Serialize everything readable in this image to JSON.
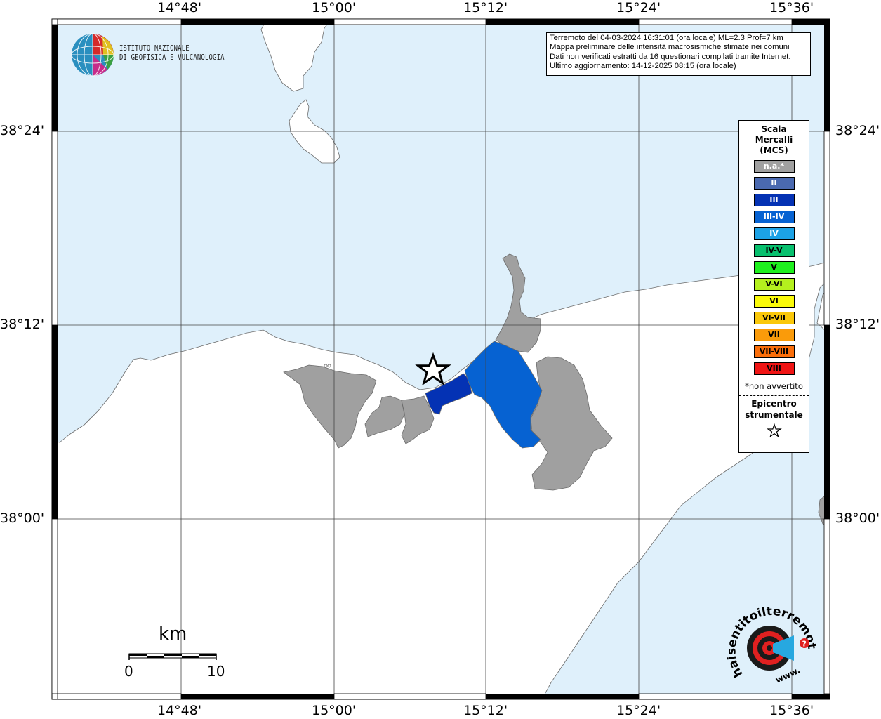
{
  "map": {
    "lon_labels": [
      "14°48'",
      "15°00'",
      "15°12'",
      "15°24'",
      "15°36'"
    ],
    "lat_labels": [
      "38°24'",
      "38°12'",
      "38°00'"
    ],
    "epicenter": {
      "label": "epicenter-star"
    },
    "colors": {
      "sea": "#dff0fb",
      "land": "#ffffff",
      "na": "#a0a0a0",
      "III": "#0432b4",
      "III-IV": "#0662d2"
    }
  },
  "info": {
    "line1": "Terremoto del 04-03-2024 16:31:01 (ora locale) ML=2.3 Prof=7 km",
    "line2": "Mappa preliminare delle intensità macrosismiche stimate nei comuni",
    "line3": "Dati non verificati estratti da 16 questionari compilati tramite Internet.",
    "line4": "Ultimo aggiornamento: 14-12-2025 08:15 (ora locale)"
  },
  "logo": {
    "line1": "ISTITUTO NAZIONALE",
    "line2": "DI GEOFISICA E VULCANOLOGIA"
  },
  "legend": {
    "title1": "Scala",
    "title2": "Mercalli",
    "title3": "(MCS)",
    "items": [
      {
        "label": "n.a.*",
        "color": "#a0a0a0",
        "text_color": "#ffffff"
      },
      {
        "label": "II",
        "color": "#4a69b0",
        "text_color": "#ffffff"
      },
      {
        "label": "III",
        "color": "#0432b4",
        "text_color": "#ffffff"
      },
      {
        "label": "III-IV",
        "color": "#0662d2",
        "text_color": "#ffffff"
      },
      {
        "label": "IV",
        "color": "#1ca2e6",
        "text_color": "#ffffff"
      },
      {
        "label": "IV-V",
        "color": "#07c06e",
        "text_color": "#000000"
      },
      {
        "label": "V",
        "color": "#1ef01e",
        "text_color": "#000000"
      },
      {
        "label": "V-VI",
        "color": "#b4f01e",
        "text_color": "#000000"
      },
      {
        "label": "VI",
        "color": "#fafa0a",
        "text_color": "#000000"
      },
      {
        "label": "VI-VII",
        "color": "#fac80a",
        "text_color": "#000000"
      },
      {
        "label": "VII",
        "color": "#fa9b0a",
        "text_color": "#000000"
      },
      {
        "label": "VII-VIII",
        "color": "#fa6e0a",
        "text_color": "#000000"
      },
      {
        "label": "VIII",
        "color": "#f01414",
        "text_color": "#000000"
      }
    ],
    "note": "*non avvertito",
    "epi1": "Epicentro",
    "epi2": "strumentale"
  },
  "scalebar": {
    "unit": "km",
    "start": "0",
    "end": "10"
  },
  "brand": {
    "text": "haisentitoilterremoto.it",
    "prefix": "www."
  }
}
